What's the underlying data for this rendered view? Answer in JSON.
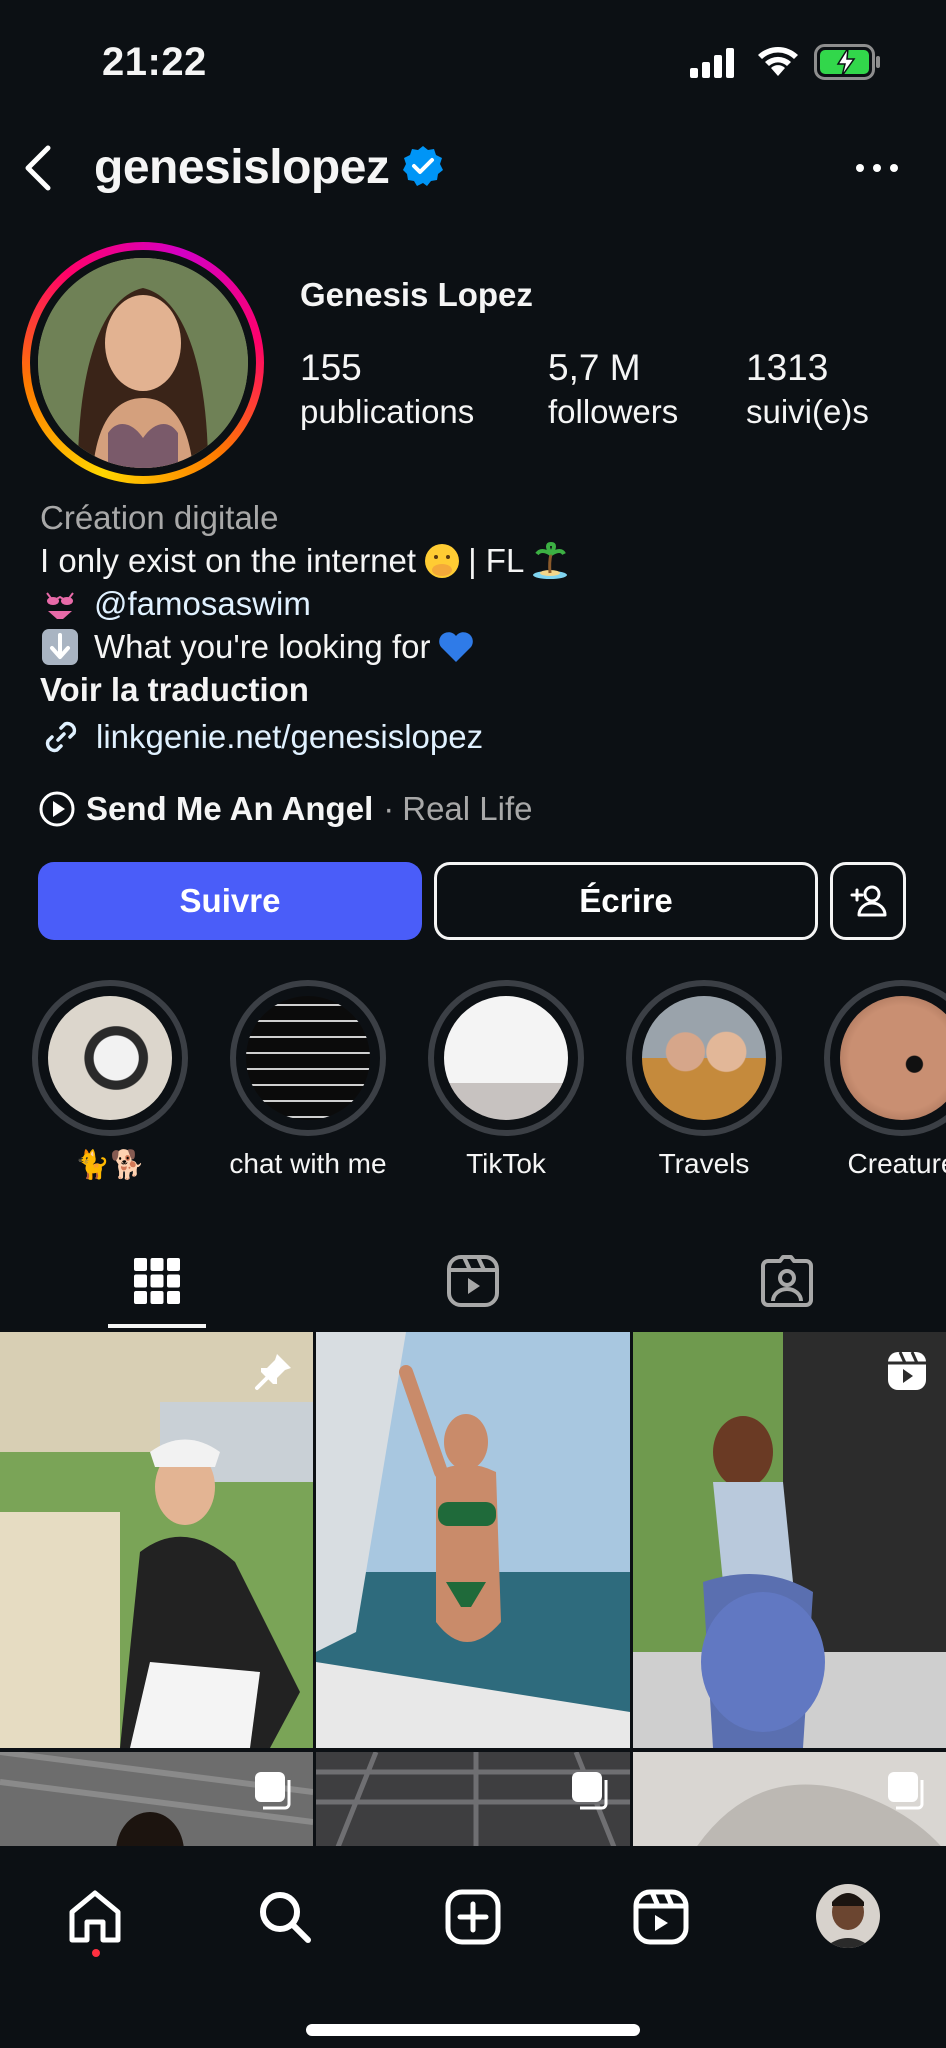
{
  "status_bar": {
    "time": "21:22",
    "icons": [
      "cellular-signal-icon",
      "wifi-icon",
      "battery-charging-icon"
    ]
  },
  "header": {
    "username": "genesislopez",
    "verified": true,
    "icons": [
      "back-chevron-icon",
      "verified-badge-icon",
      "more-dots-icon"
    ]
  },
  "profile": {
    "full_name": "Genesis Lopez",
    "stats": [
      {
        "value": "155",
        "label": "publications"
      },
      {
        "value": "5,7 M",
        "label": "followers"
      },
      {
        "value": "1313",
        "label": "suivi(e)s"
      }
    ]
  },
  "bio": {
    "category": "Création digitale",
    "line1": "I only exist on the internet",
    "line1_suffix": "| FL",
    "mention": "@famosaswim",
    "line3": "What you're looking for",
    "translate": "Voir la traduction",
    "link": "linkgenie.net/genesislopez",
    "emojis": [
      "face-with-hand-over-mouth",
      "desert-island",
      "bikini",
      "down-arrow",
      "blue-heart"
    ]
  },
  "music": {
    "title": "Send Me An Angel",
    "separator": "·",
    "artist": "Real Life"
  },
  "buttons": {
    "follow": "Suivre",
    "message": "Écrire",
    "add_user_icon": "add-user-icon"
  },
  "highlights": [
    {
      "label": "🐈🐕"
    },
    {
      "label": "chat with me"
    },
    {
      "label": "TikTok"
    },
    {
      "label": "Travels"
    },
    {
      "label": "Creature"
    }
  ],
  "tabs": [
    "grid-icon",
    "reels-icon",
    "tagged-icon"
  ],
  "grid": {
    "badges": [
      "pinned-icon",
      "",
      "reel-icon",
      "carousel-icon",
      "carousel-icon",
      "carousel-icon"
    ]
  },
  "bottom_nav": [
    "home-icon",
    "search-icon",
    "create-icon",
    "reels-icon",
    "profile-avatar"
  ],
  "colors": {
    "background": "#0c1014",
    "follow_button": "#4a5df9",
    "verified": "#0095f6",
    "link": "#e0f1ff",
    "secondary_text": "#a8a8a8"
  }
}
